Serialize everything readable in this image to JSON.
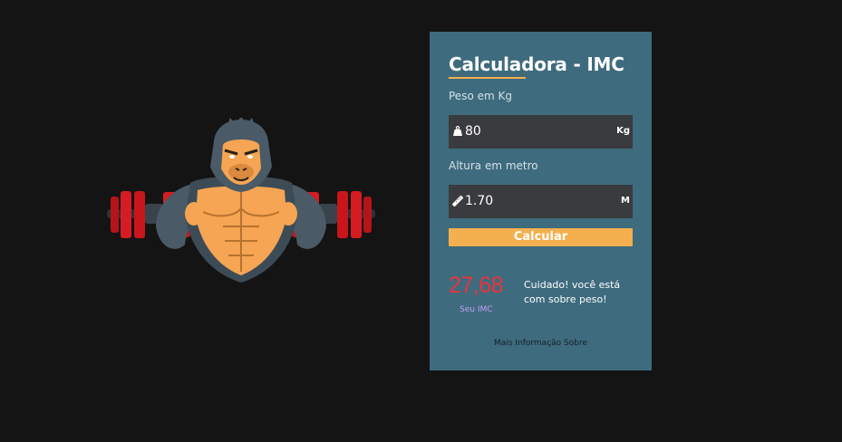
{
  "mascot": {
    "icon": "gorilla-bodybuilder-dumbbells-logo",
    "colors": {
      "skin": "#f5a553",
      "fur": "#4a5a66",
      "plates": "#c9161c",
      "bar": "#2d3238"
    }
  },
  "calculator": {
    "title": "Calculadora - IMC",
    "accent_color": "#f4b04e",
    "card_color": "#3e6b7e",
    "weight": {
      "label": "Peso em Kg",
      "value": "80",
      "unit": "Kg",
      "icon": "weight-icon"
    },
    "height": {
      "label": "Altura em metro",
      "value": "1.70",
      "unit": "M",
      "icon": "ruler-icon"
    },
    "button_label": "Calcular",
    "result": {
      "value": "27,68",
      "label": "Seu IMC",
      "message": "Cuidado! você está com sobre peso!",
      "value_color": "#e8343b"
    },
    "more_info_link": "Mais Informação Sobre"
  }
}
